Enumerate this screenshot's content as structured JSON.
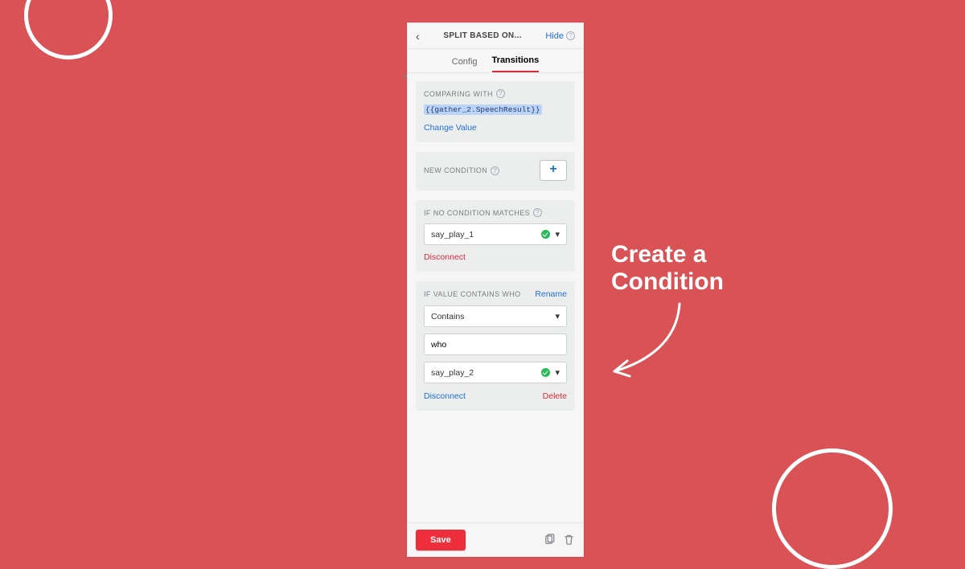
{
  "callout": {
    "line1": "Create a",
    "line2": "Condition"
  },
  "panel": {
    "title": "SPLIT BASED ON...",
    "hide": "Hide",
    "tabs": {
      "config": "Config",
      "transitions": "Transitions"
    },
    "comparing": {
      "label": "COMPARING WITH",
      "token": "{{gather_2.SpeechResult}}",
      "change": "Change Value"
    },
    "newCondition": {
      "label": "NEW CONDITION"
    },
    "noMatch": {
      "label": "IF NO CONDITION MATCHES",
      "target": "say_play_1",
      "disconnect": "Disconnect"
    },
    "cond1": {
      "label": "IF VALUE CONTAINS WHO",
      "rename": "Rename",
      "operator": "Contains",
      "value": "who",
      "target": "say_play_2",
      "disconnect": "Disconnect",
      "delete": "Delete"
    },
    "footer": {
      "save": "Save"
    }
  }
}
